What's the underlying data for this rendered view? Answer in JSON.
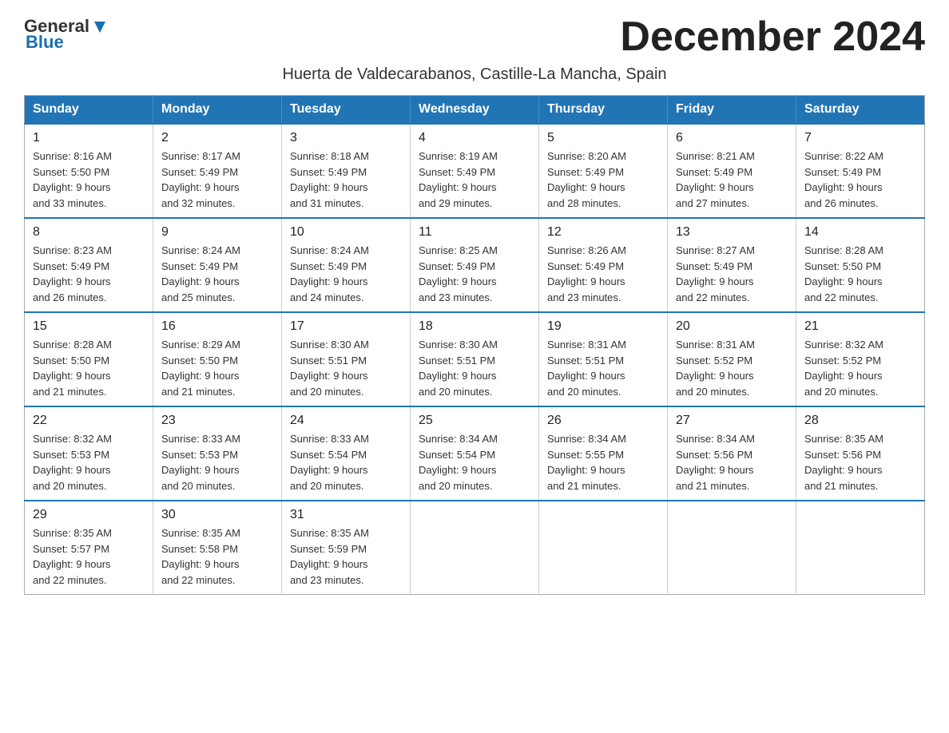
{
  "header": {
    "logo_general": "General",
    "logo_blue": "Blue",
    "month_title": "December 2024",
    "location": "Huerta de Valdecarabanos, Castille-La Mancha, Spain"
  },
  "weekdays": [
    "Sunday",
    "Monday",
    "Tuesday",
    "Wednesday",
    "Thursday",
    "Friday",
    "Saturday"
  ],
  "weeks": [
    [
      {
        "day": "1",
        "sunrise": "8:16 AM",
        "sunset": "5:50 PM",
        "daylight": "9 hours and 33 minutes."
      },
      {
        "day": "2",
        "sunrise": "8:17 AM",
        "sunset": "5:49 PM",
        "daylight": "9 hours and 32 minutes."
      },
      {
        "day": "3",
        "sunrise": "8:18 AM",
        "sunset": "5:49 PM",
        "daylight": "9 hours and 31 minutes."
      },
      {
        "day": "4",
        "sunrise": "8:19 AM",
        "sunset": "5:49 PM",
        "daylight": "9 hours and 29 minutes."
      },
      {
        "day": "5",
        "sunrise": "8:20 AM",
        "sunset": "5:49 PM",
        "daylight": "9 hours and 28 minutes."
      },
      {
        "day": "6",
        "sunrise": "8:21 AM",
        "sunset": "5:49 PM",
        "daylight": "9 hours and 27 minutes."
      },
      {
        "day": "7",
        "sunrise": "8:22 AM",
        "sunset": "5:49 PM",
        "daylight": "9 hours and 26 minutes."
      }
    ],
    [
      {
        "day": "8",
        "sunrise": "8:23 AM",
        "sunset": "5:49 PM",
        "daylight": "9 hours and 26 minutes."
      },
      {
        "day": "9",
        "sunrise": "8:24 AM",
        "sunset": "5:49 PM",
        "daylight": "9 hours and 25 minutes."
      },
      {
        "day": "10",
        "sunrise": "8:24 AM",
        "sunset": "5:49 PM",
        "daylight": "9 hours and 24 minutes."
      },
      {
        "day": "11",
        "sunrise": "8:25 AM",
        "sunset": "5:49 PM",
        "daylight": "9 hours and 23 minutes."
      },
      {
        "day": "12",
        "sunrise": "8:26 AM",
        "sunset": "5:49 PM",
        "daylight": "9 hours and 23 minutes."
      },
      {
        "day": "13",
        "sunrise": "8:27 AM",
        "sunset": "5:49 PM",
        "daylight": "9 hours and 22 minutes."
      },
      {
        "day": "14",
        "sunrise": "8:28 AM",
        "sunset": "5:50 PM",
        "daylight": "9 hours and 22 minutes."
      }
    ],
    [
      {
        "day": "15",
        "sunrise": "8:28 AM",
        "sunset": "5:50 PM",
        "daylight": "9 hours and 21 minutes."
      },
      {
        "day": "16",
        "sunrise": "8:29 AM",
        "sunset": "5:50 PM",
        "daylight": "9 hours and 21 minutes."
      },
      {
        "day": "17",
        "sunrise": "8:30 AM",
        "sunset": "5:51 PM",
        "daylight": "9 hours and 20 minutes."
      },
      {
        "day": "18",
        "sunrise": "8:30 AM",
        "sunset": "5:51 PM",
        "daylight": "9 hours and 20 minutes."
      },
      {
        "day": "19",
        "sunrise": "8:31 AM",
        "sunset": "5:51 PM",
        "daylight": "9 hours and 20 minutes."
      },
      {
        "day": "20",
        "sunrise": "8:31 AM",
        "sunset": "5:52 PM",
        "daylight": "9 hours and 20 minutes."
      },
      {
        "day": "21",
        "sunrise": "8:32 AM",
        "sunset": "5:52 PM",
        "daylight": "9 hours and 20 minutes."
      }
    ],
    [
      {
        "day": "22",
        "sunrise": "8:32 AM",
        "sunset": "5:53 PM",
        "daylight": "9 hours and 20 minutes."
      },
      {
        "day": "23",
        "sunrise": "8:33 AM",
        "sunset": "5:53 PM",
        "daylight": "9 hours and 20 minutes."
      },
      {
        "day": "24",
        "sunrise": "8:33 AM",
        "sunset": "5:54 PM",
        "daylight": "9 hours and 20 minutes."
      },
      {
        "day": "25",
        "sunrise": "8:34 AM",
        "sunset": "5:54 PM",
        "daylight": "9 hours and 20 minutes."
      },
      {
        "day": "26",
        "sunrise": "8:34 AM",
        "sunset": "5:55 PM",
        "daylight": "9 hours and 21 minutes."
      },
      {
        "day": "27",
        "sunrise": "8:34 AM",
        "sunset": "5:56 PM",
        "daylight": "9 hours and 21 minutes."
      },
      {
        "day": "28",
        "sunrise": "8:35 AM",
        "sunset": "5:56 PM",
        "daylight": "9 hours and 21 minutes."
      }
    ],
    [
      {
        "day": "29",
        "sunrise": "8:35 AM",
        "sunset": "5:57 PM",
        "daylight": "9 hours and 22 minutes."
      },
      {
        "day": "30",
        "sunrise": "8:35 AM",
        "sunset": "5:58 PM",
        "daylight": "9 hours and 22 minutes."
      },
      {
        "day": "31",
        "sunrise": "8:35 AM",
        "sunset": "5:59 PM",
        "daylight": "9 hours and 23 minutes."
      },
      null,
      null,
      null,
      null
    ]
  ],
  "labels": {
    "sunrise": "Sunrise:",
    "sunset": "Sunset:",
    "daylight": "Daylight:"
  }
}
